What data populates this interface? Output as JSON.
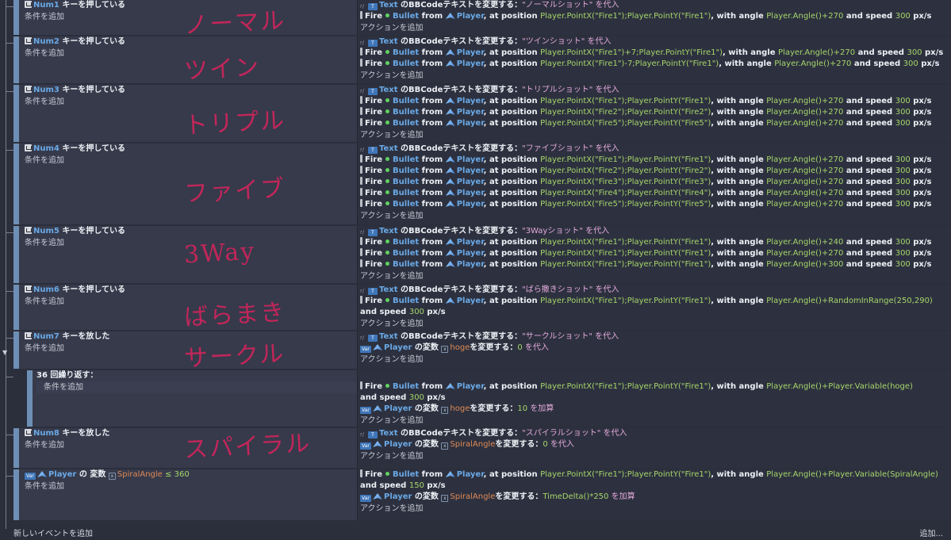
{
  "labels": {
    "add_condition": "条件を追加",
    "add_action": "アクションを追加",
    "change_text": "のBBCodeテキストを変更する：",
    "assign": "を代入",
    "add_op": "を加算",
    "fire": "Fire",
    "bullet": "Bullet",
    "from": "from",
    "player": "Player",
    "at_position": ", at position",
    "with_angle": ", with angle",
    "and_speed": "and speed",
    "pxs": "px/s",
    "variable": "の変数",
    "change_var": "を変更する：",
    "text_obj": "Text"
  },
  "events": [
    {
      "key": "Num1",
      "cond_text": "キーを押している",
      "handwriting": "ノーマル",
      "string": "\"ノーマルショット\"",
      "fires": [
        {
          "pos": "Player.PointX(\"Fire1\");Player.PointY(\"Fire1\")",
          "angle": "Player.Angle()+270",
          "speed": "300"
        }
      ]
    },
    {
      "key": "Num2",
      "cond_text": "キーを押している",
      "handwriting": "ツイン",
      "string": "\"ツインショット\"",
      "fires": [
        {
          "pos": "Player.PointX(\"Fire1\")+7;Player.PointY(\"Fire1\")",
          "angle": "Player.Angle()+270",
          "speed": "300"
        },
        {
          "pos": "Player.PointX(\"Fire1\")-7;Player.PointY(\"Fire1\")",
          "angle": "Player.Angle()+270",
          "speed": "300"
        }
      ]
    },
    {
      "key": "Num3",
      "cond_text": "キーを押している",
      "handwriting": "トリプル",
      "string": "\"トリプルショット\"",
      "fires": [
        {
          "pos": "Player.PointX(\"Fire1\");Player.PointY(\"Fire1\")",
          "angle": "Player.Angle()+270",
          "speed": "300"
        },
        {
          "pos": "Player.PointX(\"Fire2\");Player.PointY(\"Fire2\")",
          "angle": "Player.Angle()+270",
          "speed": "300"
        },
        {
          "pos": "Player.PointX(\"Fire5\");Player.PointY(\"Fire5\")",
          "angle": "Player.Angle()+270",
          "speed": "300"
        }
      ]
    },
    {
      "key": "Num4",
      "cond_text": "キーを押している",
      "handwriting": "ファイブ",
      "string": "\"ファイブショット\"",
      "fires": [
        {
          "pos": "Player.PointX(\"Fire1\");Player.PointY(\"Fire1\")",
          "angle": "Player.Angle()+270",
          "speed": "300"
        },
        {
          "pos": "Player.PointX(\"Fire2\");Player.PointY(\"Fire2\")",
          "angle": "Player.Angle()+270",
          "speed": "300"
        },
        {
          "pos": "Player.PointX(\"Fire3\");Player.PointY(\"Fire3\")",
          "angle": "Player.Angle()+270",
          "speed": "300"
        },
        {
          "pos": "Player.PointX(\"Fire4\");Player.PointY(\"Fire4\")",
          "angle": "Player.Angle()+270",
          "speed": "300"
        },
        {
          "pos": "Player.PointX(\"Fire5\");Player.PointY(\"Fire5\")",
          "angle": "Player.Angle()+270",
          "speed": "300"
        }
      ]
    },
    {
      "key": "Num5",
      "cond_text": "キーを押している",
      "handwriting": "3Way",
      "string": "\"3Wayショット\"",
      "fires": [
        {
          "pos": "Player.PointX(\"Fire1\");Player.PointY(\"Fire1\")",
          "angle": "Player.Angle()+240",
          "speed": "300"
        },
        {
          "pos": "Player.PointX(\"Fire1\");Player.PointY(\"Fire1\")",
          "angle": "Player.Angle()+270",
          "speed": "300"
        },
        {
          "pos": "Player.PointX(\"Fire1\");Player.PointY(\"Fire1\")",
          "angle": "Player.Angle()+300",
          "speed": "300"
        }
      ]
    },
    {
      "key": "Num6",
      "cond_text": "キーを押している",
      "handwriting": "ばらまき",
      "string": "\"ばら撒きショット\"",
      "fires": [
        {
          "pos": "Player.PointX(\"Fire1\");Player.PointY(\"Fire1\")",
          "angle": "Player.Angle()+RandomInRange(250,290)",
          "speed": "300"
        }
      ]
    },
    {
      "key": "Num7",
      "cond_text": "キーを放した",
      "handwriting": "サークル",
      "string": "\"サークルショット\"",
      "var_action": {
        "var": "hoge",
        "value": "0",
        "op": "を代入"
      }
    },
    {
      "key": "Num8",
      "cond_text": "キーを放した",
      "handwriting": "スパイラル",
      "string": "\"スパイラルショット\"",
      "var_action": {
        "var": "SpiralAngle",
        "value": "0",
        "op": "を代入"
      }
    }
  ],
  "repeat": {
    "title": "36 回繰り返す：",
    "fire": {
      "pos": "Player.PointX(\"Fire1\");Player.PointY(\"Fire1\")",
      "angle": "Player.Angle()+Player.Variable(hoge)",
      "speed": "300"
    },
    "var_action": {
      "var": "hoge",
      "value": "10",
      "op": "を加算"
    }
  },
  "spiral": {
    "cond_var": "SpiralAngle",
    "cond_op": "≤",
    "cond_value": "360",
    "fire": {
      "pos": "Player.PointX(\"Fire1\");Player.PointY(\"Fire1\")",
      "angle": "Player.Angle()+Player.Variable(SpiralAngle)",
      "speed": "150"
    },
    "var_action": {
      "var": "SpiralAngle",
      "value": "TimeDelta()*250",
      "op": "を加算"
    }
  },
  "footer": {
    "add_event": "新しいイベントを追加",
    "add_more": "追加..."
  },
  "colors": {
    "background": "#2b2e3b",
    "event_bg": "#363a4b",
    "action_bg": "#2d313f",
    "bar": "#6e8fb5",
    "highlight": "#6aa9e6",
    "expression": "#a6d56a",
    "string": "#e2a8d9",
    "handwriting": "#d1245b"
  }
}
